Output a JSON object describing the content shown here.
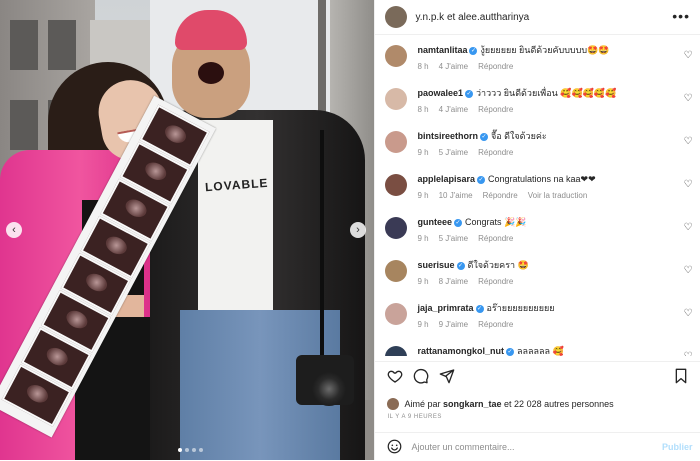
{
  "post": {
    "header_names": "y.n.p.k et alee.auttharinya",
    "photo_shirt_print": "LOVABLE",
    "prev_arrow": "‹",
    "next_arrow": "›"
  },
  "comments": [
    {
      "user": "namtanlitaa",
      "text": "งู้ยยยยยย ยินดีด้วยคับบบบบ🤩🤩",
      "time": "8 h",
      "likes": "4 J'aime",
      "reply": "Répondre",
      "avatar_color": "#b08a6a"
    },
    {
      "user": "paowalee1",
      "text": "ว่าววว ยินดีด้วยเพื่อน 🥰🥰🥰🥰🥰",
      "time": "8 h",
      "likes": "4 J'aime",
      "reply": "Répondre",
      "avatar_color": "#d7b9a7"
    },
    {
      "user": "bintsireethorn",
      "text": "จื๊อ ดีใจด้วยค่ะ",
      "time": "9 h",
      "likes": "5 J'aime",
      "reply": "Répondre",
      "avatar_color": "#c99a8c"
    },
    {
      "user": "applelapisara",
      "text": "Congratulations na kaa❤❤",
      "time": "9 h",
      "likes": "10 J'aime",
      "reply": "Répondre",
      "extra": "Voir la traduction",
      "avatar_color": "#7a4e42"
    },
    {
      "user": "gunteee",
      "text": "Congrats 🎉🎉",
      "time": "9 h",
      "likes": "5 J'aime",
      "reply": "Répondre",
      "avatar_color": "#3a3a55"
    },
    {
      "user": "suerisue",
      "text": "ดีใจด้วยครา 🤩",
      "time": "9 h",
      "likes": "8 J'aime",
      "reply": "Répondre",
      "avatar_color": "#a7855f"
    },
    {
      "user": "jaja_primrata",
      "text": "อร๊ายยยยยยยยยย",
      "time": "9 h",
      "likes": "9 J'aime",
      "reply": "Répondre",
      "avatar_color": "#c9a39a"
    },
    {
      "user": "rattanamongkol_nut",
      "text": "ลลลลลล 🥰",
      "time": "",
      "likes": "",
      "reply": "",
      "avatar_color": "#2f3f57"
    }
  ],
  "likes_line": {
    "prefix": "Aimé par",
    "user": "songkarn_tae",
    "rest": "et 22 028 autres personnes"
  },
  "date": "IL Y A 9 HEURES",
  "add_comment": {
    "placeholder": "Ajouter un commentaire...",
    "publish": "Publier"
  },
  "icons": {
    "heart": "heart-icon",
    "comment": "comment-icon",
    "share": "share-icon",
    "bookmark": "bookmark-icon",
    "emoji": "emoji-icon",
    "more": "more-options-icon"
  },
  "colors": {
    "verified": "#3897f0",
    "publish_disabled": "#b2dffc",
    "meta_gray": "#8e8e8e"
  }
}
